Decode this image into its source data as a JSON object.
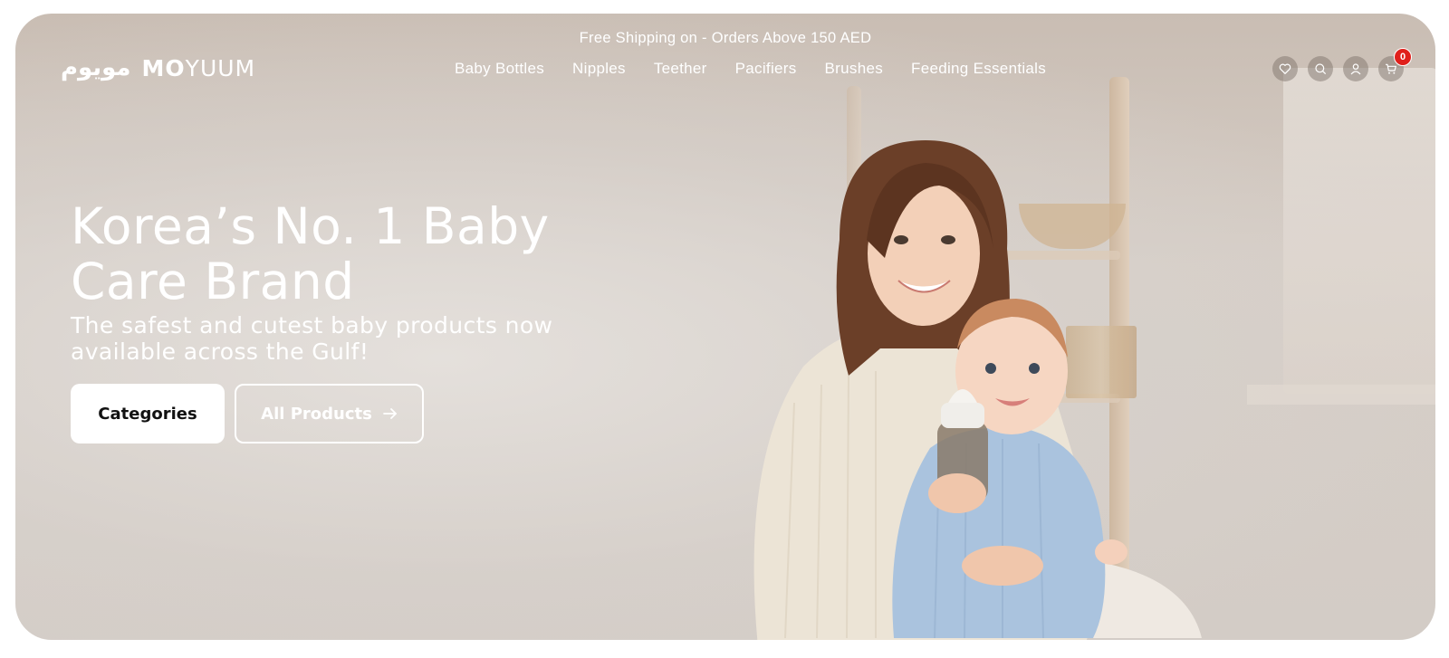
{
  "announcement": "Free Shipping on - Orders Above 150 AED",
  "logo": {
    "arabic": "مويوم",
    "latin_bold": "MO",
    "latin_light": "YUUM"
  },
  "nav": [
    {
      "label": "Baby Bottles"
    },
    {
      "label": "Nipples"
    },
    {
      "label": "Teether"
    },
    {
      "label": "Pacifiers"
    },
    {
      "label": "Brushes"
    },
    {
      "label": "Feeding Essentials"
    }
  ],
  "header_icons": [
    "heart-icon",
    "search-icon",
    "user-icon",
    "cart-icon"
  ],
  "cart_count": "0",
  "hero": {
    "headline": "Korea’s No. 1 Baby Care Brand",
    "subline": "The safest and cutest baby products now available across the Gulf!",
    "primary_button": "Categories",
    "secondary_button": "All Products",
    "secondary_button_icon": "arrow-right-icon"
  },
  "colors": {
    "badge": "#e0201b",
    "text": "#ffffff",
    "button_bg": "#ffffff",
    "button_text": "#111111"
  }
}
